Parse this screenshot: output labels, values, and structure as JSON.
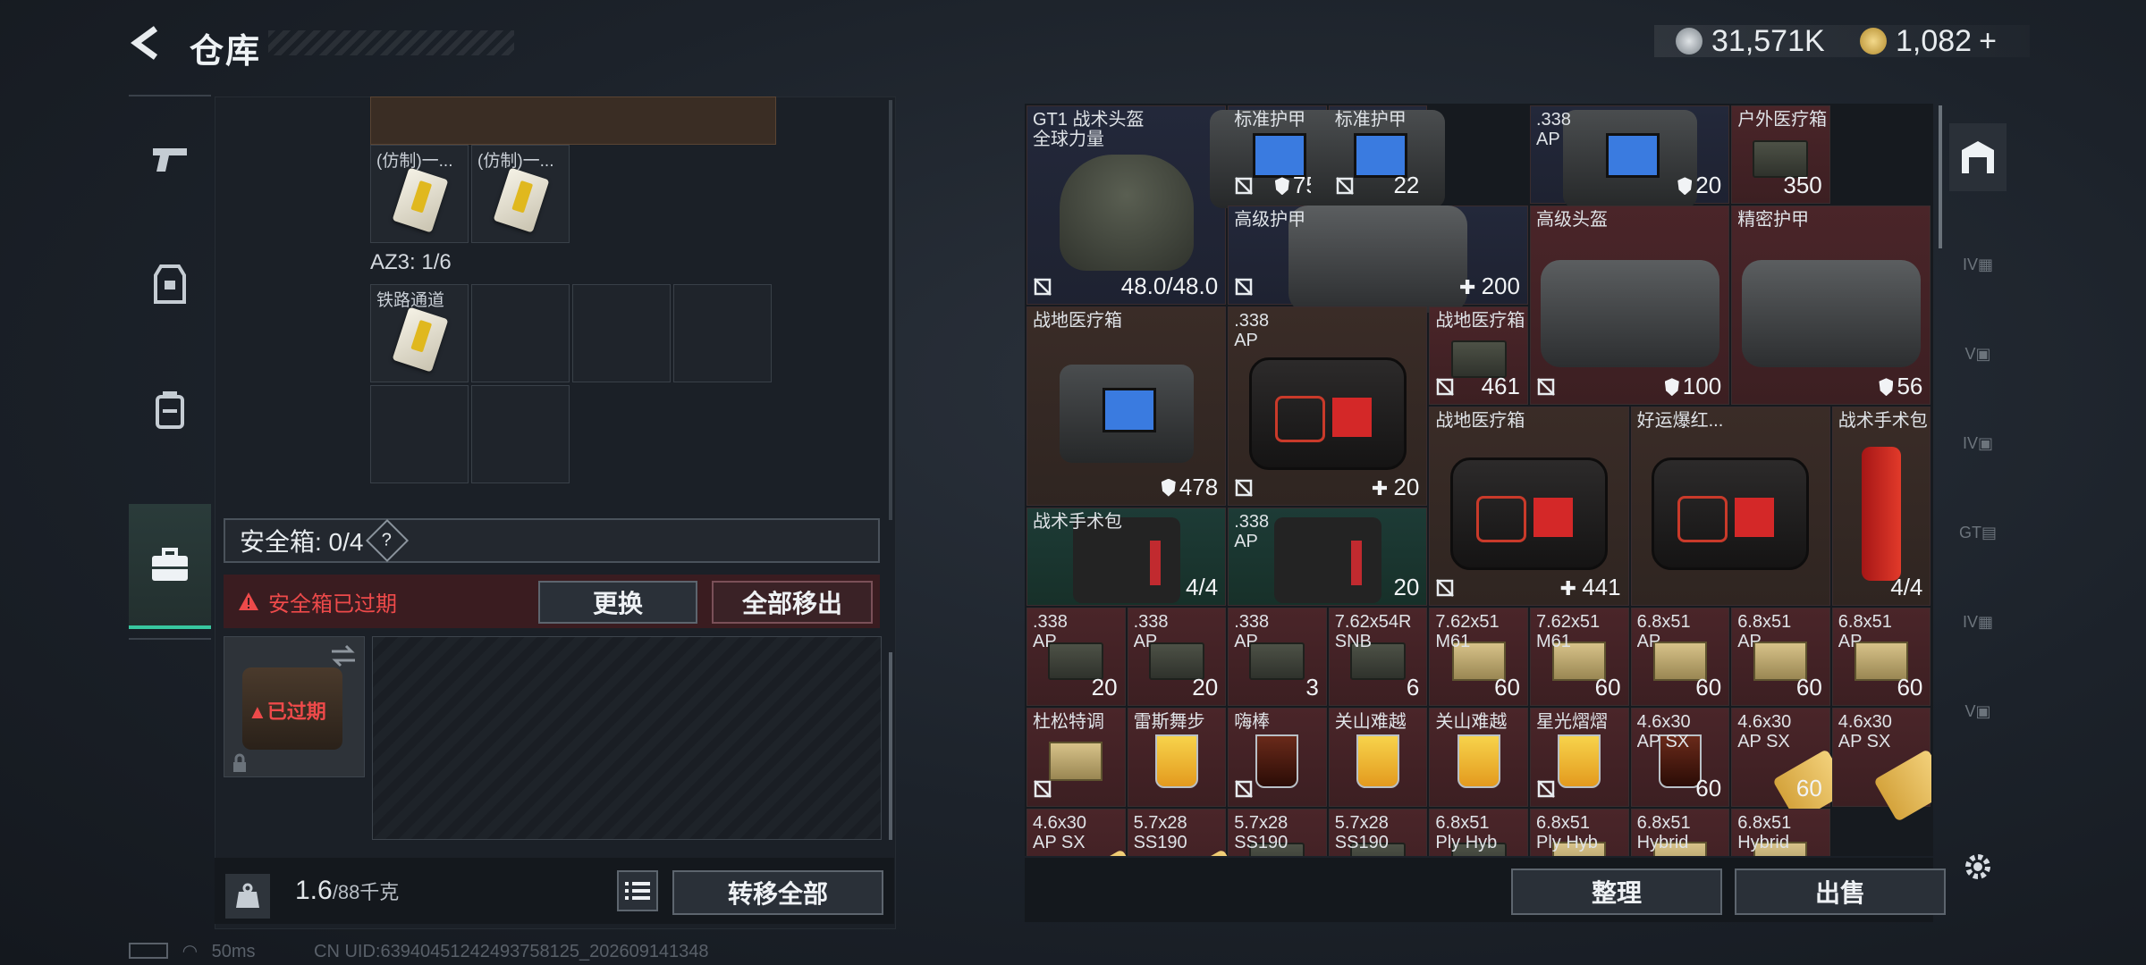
{
  "header": {
    "title": "仓库",
    "currency1": "31,571K",
    "currency2": "1,082",
    "plus": "+"
  },
  "left": {
    "grid_labels": [
      "(仿制)一...",
      "(仿制)一..."
    ],
    "zone": "AZ3: 1/6",
    "zone_item": "铁路通道",
    "safe_label": "安全箱: 0/4",
    "help": "?",
    "expired_notice": "安全箱已过期",
    "replace": "更换",
    "remove_all": "全部移出",
    "case_status": "已过期",
    "weight": "1.6",
    "weight_cap": "/88千克",
    "transfer_all": "转移全部"
  },
  "status": {
    "ping": "50ms",
    "uid": "CN UID:63940451242493758125_202609141348"
  },
  "items": [
    {
      "name": "GT1 战术头盔\n全球力量",
      "val": "48.0/48.0"
    },
    {
      "name": "标准护甲",
      "val": "75"
    },
    {
      "name": "标准护甲",
      "val": "22"
    },
    {
      "name": ".338\nAP",
      "val": "20"
    },
    {
      "name": "户外医疗箱",
      "val": "350"
    },
    {
      "name": "高级护甲",
      "val": "200"
    },
    {
      "name": "高级头盔",
      "val": "100"
    },
    {
      "name": "精密护甲",
      "val": "56"
    },
    {
      "name": "战地医疗箱",
      "val": "478"
    },
    {
      "name": ".338\nAP",
      "val": "20"
    },
    {
      "name": "战地医疗箱",
      "val": "461"
    },
    {
      "name": "战地医疗箱",
      "val": "441"
    },
    {
      "name": "好运爆红...",
      "val": ""
    },
    {
      "name": "战术手术包",
      "val": "4/4"
    },
    {
      "name": "战术手术包",
      "val": "4/4"
    },
    {
      "name": ".338\nAP",
      "val": "20"
    },
    {
      "name": ".338\nAP",
      "val": "20"
    },
    {
      "name": ".338\nAP",
      "val": "20"
    },
    {
      "name": ".338\nAP",
      "val": "3"
    },
    {
      "name": "7.62x54R\nSNB",
      "val": "6"
    },
    {
      "name": "7.62x51\nM61",
      "val": "60"
    },
    {
      "name": "7.62x51\nM61",
      "val": "60"
    },
    {
      "name": "6.8x51\nAP",
      "val": "60"
    },
    {
      "name": "6.8x51\nAP",
      "val": "60"
    },
    {
      "name": "6.8x51\nAP",
      "val": "60"
    },
    {
      "name": "杜松特调",
      "val": ""
    },
    {
      "name": "雷斯舞步",
      "val": ""
    },
    {
      "name": "嗨棒",
      "val": ""
    },
    {
      "name": "关山难越",
      "val": ""
    },
    {
      "name": "关山难越",
      "val": ""
    },
    {
      "name": "星光熠熠",
      "val": ""
    },
    {
      "name": "4.6x30\nAP SX",
      "val": "60"
    },
    {
      "name": "4.6x30\nAP SX",
      "val": "60"
    },
    {
      "name": "4.6x30\nAP SX",
      "val": ""
    },
    {
      "name": "4.6x30\nAP SX",
      "val": ""
    },
    {
      "name": "5.7x28\nSS190",
      "val": ""
    },
    {
      "name": "5.7x28\nSS190",
      "val": ""
    },
    {
      "name": "5.7x28\nSS190",
      "val": ""
    },
    {
      "name": "6.8x51\nPly Hyb",
      "val": ""
    },
    {
      "name": "6.8x51\nPly Hyb",
      "val": ""
    },
    {
      "name": "6.8x51\nHybrid",
      "val": ""
    },
    {
      "name": "6.8x51\nHybrid",
      "val": ""
    }
  ],
  "right": {
    "sort": "整理",
    "sell": "出售"
  },
  "colors": {
    "accent": "#38c7a0",
    "warn": "#ee4a4a",
    "red_tile": "#4a2529"
  }
}
